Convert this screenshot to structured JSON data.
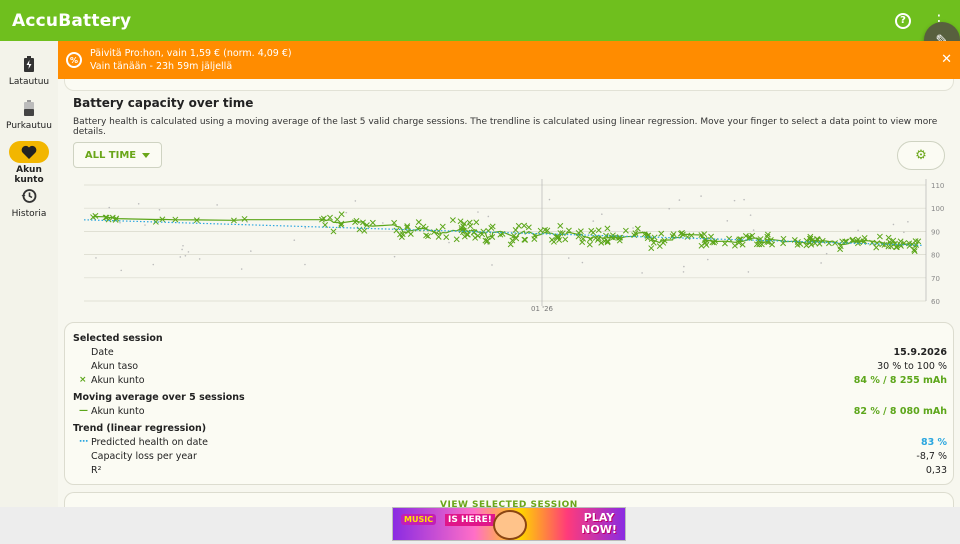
{
  "app": {
    "title": "AccuBattery"
  },
  "nav": [
    {
      "label": "Latautuu",
      "icon": "battery-charging-icon",
      "active": false
    },
    {
      "label": "Purkautuu",
      "icon": "battery-discharging-icon",
      "active": false
    },
    {
      "label": "Akun kunto",
      "icon": "heart-icon",
      "active": true
    },
    {
      "label": "Historia",
      "icon": "history-icon",
      "active": false
    }
  ],
  "promo": {
    "line1": "Päivitä Pro:hon, vain 1,59 € (norm. 4,09 €)",
    "line2": "Vain tänään - 23h 59m jäljellä"
  },
  "section": {
    "title": "Battery capacity over time",
    "description": "Battery health is calculated using a moving average of the last 5 valid charge sessions. The trendline is calculated using linear regression. Move your finger to select a data point to view more details.",
    "range_label": "ALL TIME"
  },
  "chart_data": {
    "type": "scatter",
    "y_ticks": [
      "110",
      "100",
      "90",
      "80",
      "70",
      "60"
    ],
    "ylim": [
      60,
      110
    ],
    "x_tick_label": "01 '26",
    "series": [
      {
        "name": "Akun kunto",
        "values": [],
        "color": "#5ca61a"
      },
      {
        "name": "Moving average over 5 sessions",
        "values": [],
        "color": "#5ca61a"
      },
      {
        "name": "Predicted health on date",
        "values": [],
        "color": "#2aa6df"
      }
    ]
  },
  "session": {
    "selected_header": "Selected session",
    "date_label": "Date",
    "date_value": "15.9.2026",
    "level_label": "Akun taso",
    "level_value": "30 % to 100 %",
    "health_label": "Akun kunto",
    "health_value": "84 % / 8 255 mAh",
    "moving_header": "Moving average over 5 sessions",
    "moving_label": "Akun kunto",
    "moving_value": "82 % / 8 080 mAh",
    "trend_header": "Trend (linear regression)",
    "predicted_label": "Predicted health on date",
    "predicted_value": "83 %",
    "loss_label": "Capacity loss per year",
    "loss_value": "-8,7 %",
    "r2_label": "R²",
    "r2_value": "0,33"
  },
  "bottom": {
    "view_label": "VIEW SELECTED SESSION"
  },
  "ad": {
    "text1": "MUSIC",
    "text2": "IS HERE!",
    "text3": "PLAY NOW!"
  },
  "colors": {
    "accent": "#6fbf1e",
    "promo": "#ff8c00",
    "active_nav": "#f2b600"
  }
}
